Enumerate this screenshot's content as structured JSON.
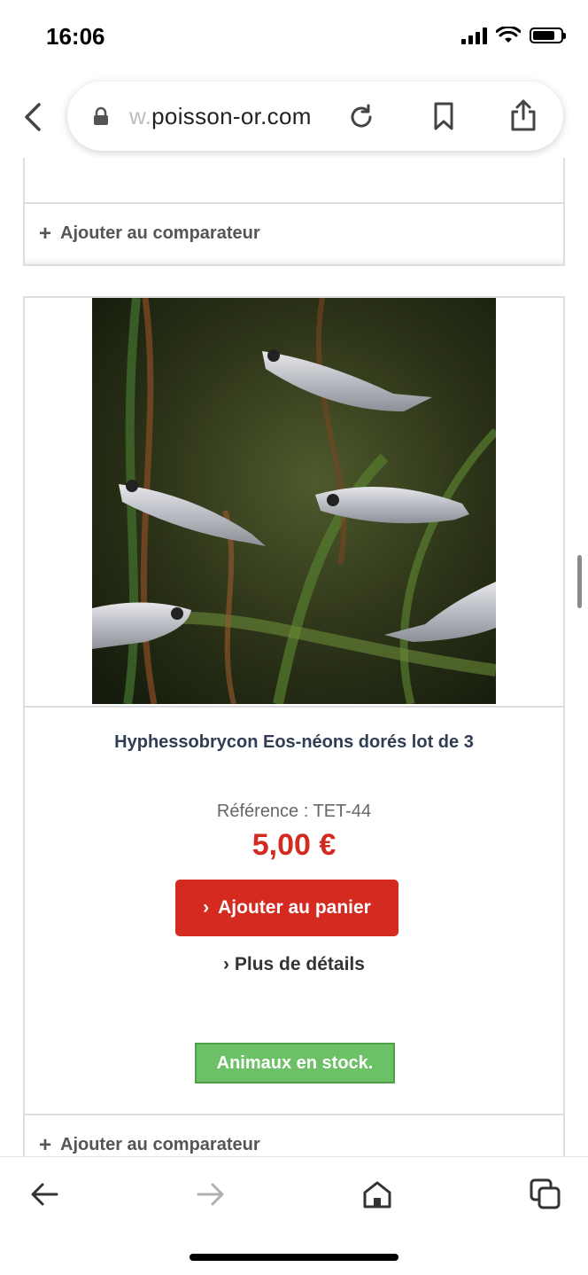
{
  "status_bar": {
    "time": "16:06"
  },
  "browser": {
    "url_faded": "w.",
    "url_main": "poisson-or.com"
  },
  "prev_card": {
    "compare_label": "Ajouter au comparateur"
  },
  "product": {
    "title": "Hyphessobrycon Eos-néons dorés lot de 3",
    "reference": "Référence : TET-44",
    "price": "5,00 €",
    "add_to_cart": "Ajouter au panier",
    "more_details": "Plus de détails",
    "stock_badge": "Animaux en stock.",
    "compare_label": "Ajouter au comparateur",
    "colors": {
      "price": "#d32b1f",
      "cart_button": "#d42a20",
      "stock_badge": "#6cc065"
    }
  },
  "toolbar": {
    "icons": [
      "back-arrow-icon",
      "forward-arrow-icon",
      "home-icon",
      "tabs-icon"
    ]
  }
}
